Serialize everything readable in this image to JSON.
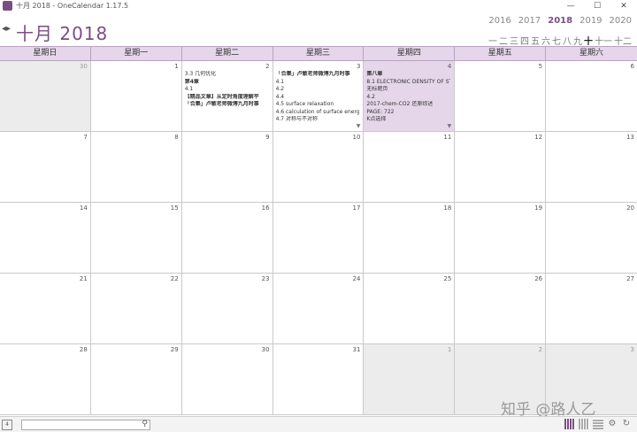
{
  "window": {
    "title": "十月 2018 - OneCalendar 1.17.5",
    "minimize": "—",
    "maximize": "☐",
    "close": "✕"
  },
  "header": {
    "nav_arrows": "◂▸",
    "month_title": "十月 2018",
    "years": [
      "2016",
      "2017",
      "2018",
      "2019",
      "2020"
    ],
    "active_year": "2018",
    "months": [
      "一",
      "二",
      "三",
      "四",
      "五",
      "六",
      "七",
      "八",
      "九",
      "十",
      "十一",
      "十二"
    ],
    "active_month": "十"
  },
  "weekdays": [
    "星期日",
    "星期一",
    "星期二",
    "星期三",
    "星期四",
    "星期五",
    "星期六"
  ],
  "weeks": [
    [
      {
        "day": "30",
        "other": true,
        "events": []
      },
      {
        "day": "1",
        "events": []
      },
      {
        "day": "2",
        "events": [
          {
            "text": "3.3 几何优化"
          },
          {
            "text": "第4章",
            "bold": true
          },
          {
            "text": "4.1"
          },
          {
            "text": "【精品文章】从定时角度理解平",
            "bold": true
          },
          {
            "text": "「合集」卢敏老师微博九月时事",
            "bold": true
          }
        ]
      },
      {
        "day": "3",
        "more": "▼",
        "events": [
          {
            "text": "「合集」卢敏老师微博九月时事",
            "bold": true
          },
          {
            "text": "4.1"
          },
          {
            "text": "4.2"
          },
          {
            "text": "4.4"
          },
          {
            "text": "4.5 surface relaxation"
          },
          {
            "text": "4.6 calculation of surface energ"
          },
          {
            "text": "4.7 对称与不对称"
          }
        ]
      },
      {
        "day": "4",
        "today": true,
        "more": "▼",
        "events": [
          {
            "text": "第八章",
            "bold": true
          },
          {
            "text": "8.1 ELECTRONIC DENSITY OF STAT"
          },
          {
            "text": "无标题页"
          },
          {
            "text": "4.2"
          },
          {
            "text": "2017-chem-CO2 还原综述"
          },
          {
            "text": "PAGE: 722"
          },
          {
            "text": "K点选择"
          }
        ]
      },
      {
        "day": "5",
        "events": []
      },
      {
        "day": "6",
        "events": []
      }
    ],
    [
      {
        "day": "7",
        "events": []
      },
      {
        "day": "8",
        "events": []
      },
      {
        "day": "9",
        "events": []
      },
      {
        "day": "10",
        "events": []
      },
      {
        "day": "11",
        "events": []
      },
      {
        "day": "12",
        "events": []
      },
      {
        "day": "13",
        "events": []
      }
    ],
    [
      {
        "day": "14",
        "events": []
      },
      {
        "day": "15",
        "events": []
      },
      {
        "day": "16",
        "events": []
      },
      {
        "day": "17",
        "events": []
      },
      {
        "day": "18",
        "events": []
      },
      {
        "day": "19",
        "events": []
      },
      {
        "day": "20",
        "events": []
      }
    ],
    [
      {
        "day": "21",
        "events": []
      },
      {
        "day": "22",
        "events": []
      },
      {
        "day": "23",
        "events": []
      },
      {
        "day": "24",
        "events": []
      },
      {
        "day": "25",
        "events": []
      },
      {
        "day": "26",
        "events": []
      },
      {
        "day": "27",
        "events": []
      }
    ],
    [
      {
        "day": "28",
        "events": []
      },
      {
        "day": "29",
        "events": []
      },
      {
        "day": "30",
        "events": []
      },
      {
        "day": "31",
        "events": []
      },
      {
        "day": "1",
        "other": true,
        "events": []
      },
      {
        "day": "2",
        "other": true,
        "events": []
      },
      {
        "day": "3",
        "other": true,
        "events": []
      }
    ]
  ],
  "statusbar": {
    "today_icon": "4",
    "search_value": "",
    "search_icon": "⚲",
    "settings_icon": "⚙",
    "sync_icon": "↻"
  },
  "watermark": "知乎 @路人乙"
}
